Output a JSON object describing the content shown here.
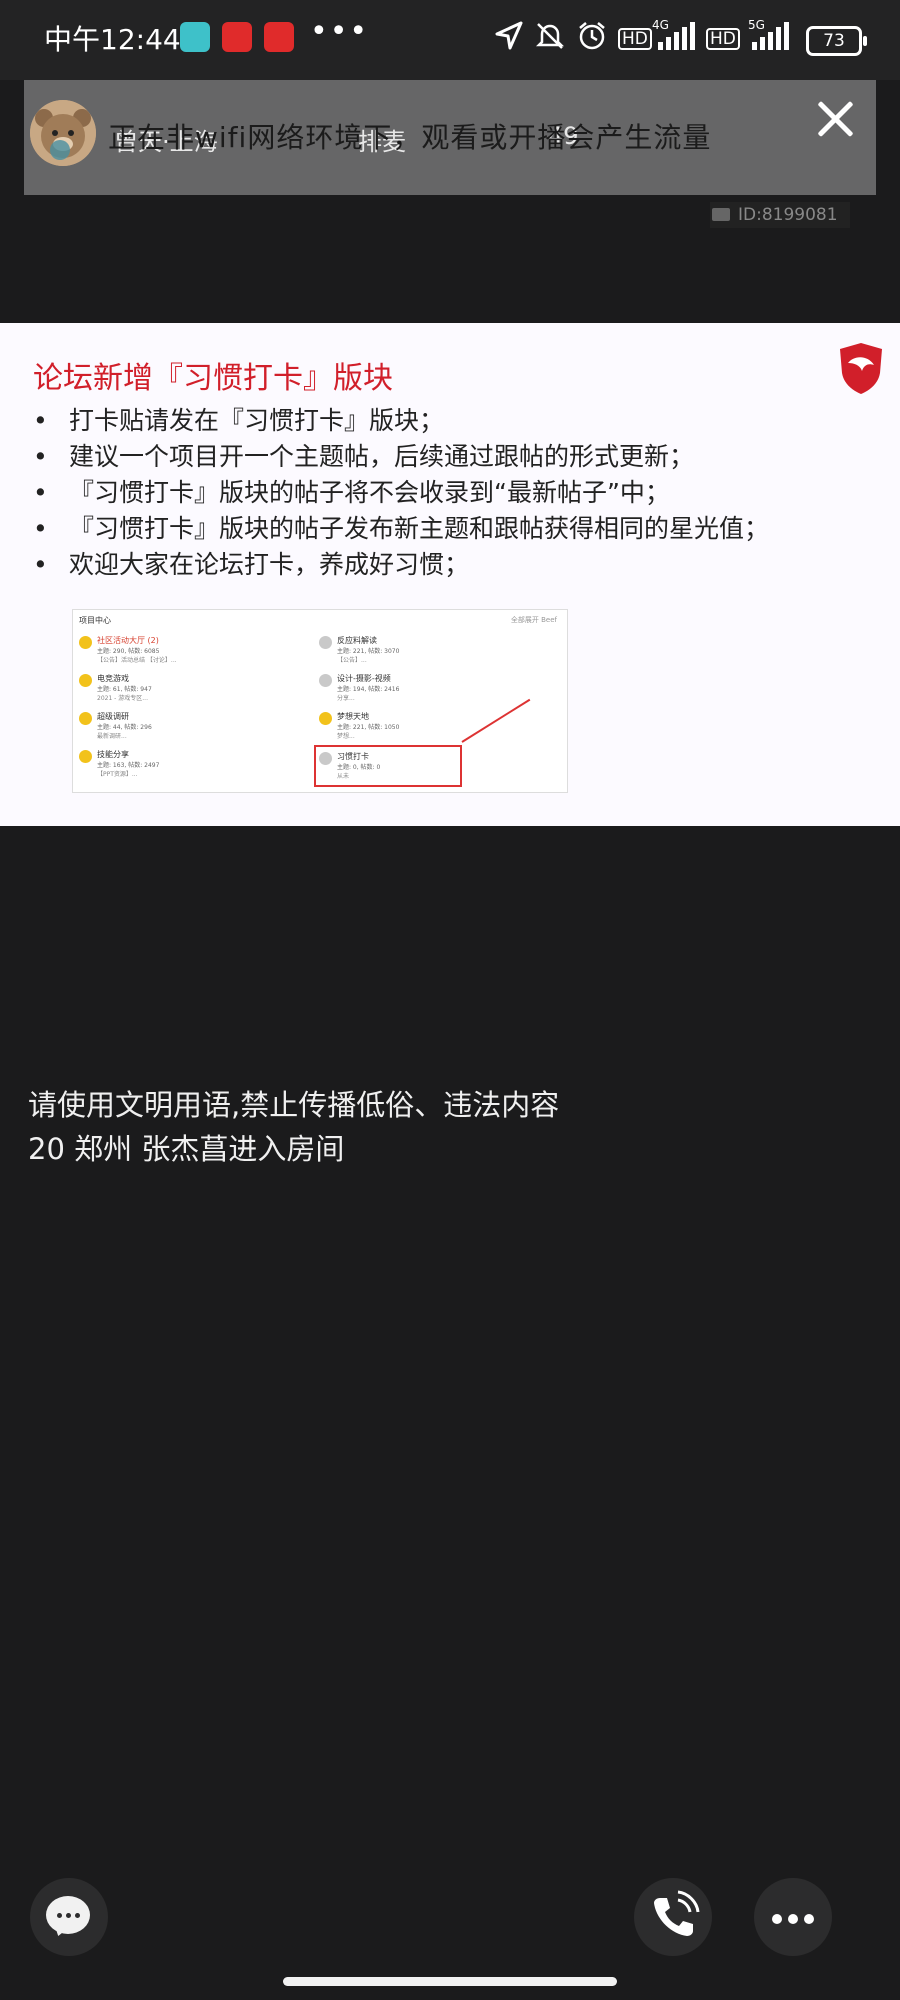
{
  "status_bar": {
    "time": "中午12:44",
    "more_dots": "•••",
    "network_1": "4G",
    "network_2": "5G",
    "hd_1": "HD",
    "hd_2": "HD",
    "battery": "73"
  },
  "live_header": {
    "host_name": "曾天·上海",
    "rank_label": "排麦",
    "viewer_count": "49",
    "network_notice": "正在非wifi网络环境下，观看或开播会产生流量",
    "room_id": "ID:8199081"
  },
  "slide": {
    "title": "论坛新增『习惯打卡』版块",
    "bullets": [
      "打卡贴请发在『习惯打卡』版块；",
      "建议一个项目开一个主题帖，后续通过跟帖的形式更新；",
      "『习惯打卡』版块的帖子将不会收录到“最新帖子”中；",
      "『习惯打卡』版块的帖子发布新主题和跟帖获得相同的星光值；",
      "欢迎大家在论坛打卡，养成好习惯；"
    ],
    "screenshot": {
      "header": "项目中心",
      "header_right": "全部展开 Beef",
      "left_items": [
        {
          "name": "社区活动大厅 (2)",
          "stats": "主题: 290, 帖数: 6085",
          "line": "【公告】活动总结 【讨论】..."
        },
        {
          "name": "电竞游戏",
          "stats": "主题: 61, 帖数: 947",
          "line": "2021 - 游戏专区..."
        },
        {
          "name": "超级调研",
          "stats": "主题: 44, 帖数: 296",
          "line": "最新调研..."
        },
        {
          "name": "技能分享",
          "stats": "主题: 163, 帖数: 2497",
          "line": "【PPT资源】..."
        }
      ],
      "right_items": [
        {
          "name": "反应料解读",
          "stats": "主题: 221, 帖数: 3070",
          "line": "【公告】..."
        },
        {
          "name": "设计-摄影-视频",
          "stats": "主题: 194, 帖数: 2416",
          "line": "分享..."
        },
        {
          "name": "梦想天地",
          "stats": "主题: 221, 帖数: 1050",
          "line": "梦想..."
        },
        {
          "name": "习惯打卡",
          "stats": "主题: 0, 帖数: 0",
          "line": "从未"
        }
      ]
    }
  },
  "chat": {
    "system_message": "请使用文明用语,禁止传播低俗、违法内容",
    "entry_message": "20 郑州 张杰菖进入房间"
  },
  "colors": {
    "background": "#1b1b1c",
    "accent_red": "#d11f2a",
    "slide_bg": "#fcfaff"
  },
  "icons": [
    "navigation-icon",
    "mute-icon",
    "alarm-icon",
    "signal-icon",
    "close-icon",
    "video-camera-icon",
    "chat-bubble-icon",
    "phone-call-icon",
    "more-icon"
  ]
}
